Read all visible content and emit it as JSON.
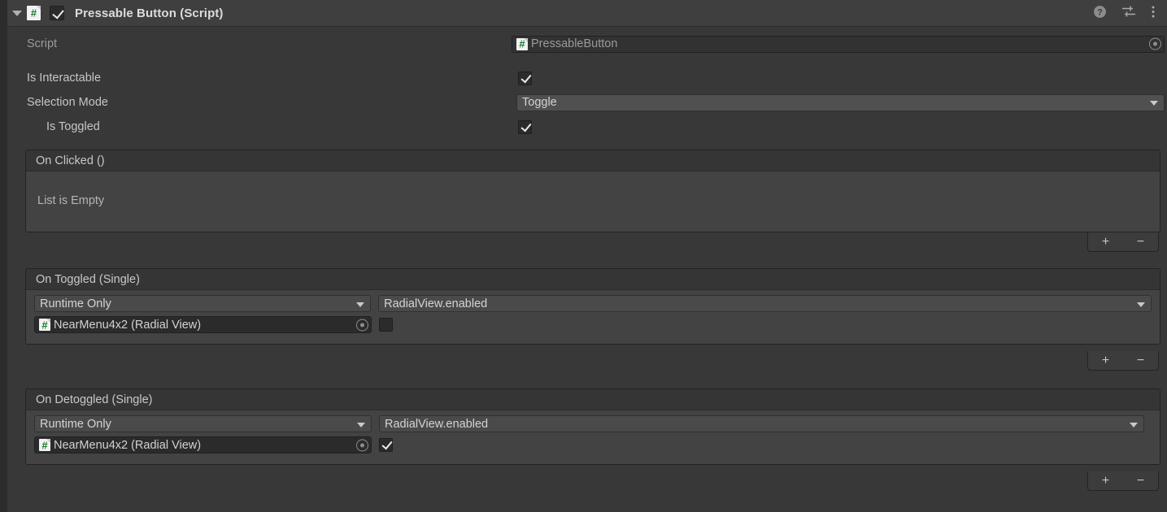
{
  "component": {
    "title": "Pressable Button (Script)",
    "enabled": true,
    "expanded": true,
    "foldout_icon": "triangle-down-icon",
    "script_badge_icon": "csharp-script-icon",
    "header_icons": [
      {
        "name": "help-icon",
        "glyph": "?"
      },
      {
        "name": "preset-icon",
        "glyph": "sliders"
      },
      {
        "name": "more-menu-icon",
        "glyph": "kebab"
      }
    ]
  },
  "fields": {
    "script": {
      "label": "Script",
      "value": "PressableButton",
      "icon": "csharp-script-icon",
      "picker_icon": "object-picker-icon",
      "readonly": true
    },
    "is_interactable": {
      "label": "Is Interactable",
      "checked": true
    },
    "selection_mode": {
      "label": "Selection Mode",
      "value": "Toggle",
      "arrow_icon": "chevron-down-icon"
    },
    "is_toggled": {
      "label": "Is Toggled",
      "checked": true,
      "indented": true
    }
  },
  "events": [
    {
      "id": "on-clicked",
      "header": "On Clicked ()",
      "empty": true,
      "empty_text": "List is Empty",
      "entries": [],
      "footer": {
        "add_label": "+",
        "remove_label": "−"
      }
    },
    {
      "id": "on-toggled",
      "header": "On Toggled (Single)",
      "empty": false,
      "entries": [
        {
          "call_state": "Runtime Only",
          "method": "RadialView.enabled",
          "target_object": "NearMenu4x2 (Radial View)",
          "target_icon": "csharp-script-icon",
          "picker_icon": "object-picker-icon",
          "arg_checked": false
        }
      ],
      "footer": {
        "add_label": "+",
        "remove_label": "−"
      }
    },
    {
      "id": "on-detoggled",
      "header": "On Detoggled (Single)",
      "empty": false,
      "entries": [
        {
          "call_state": "Runtime Only",
          "method": "RadialView.enabled",
          "target_object": "NearMenu4x2 (Radial View)",
          "target_icon": "csharp-script-icon",
          "picker_icon": "object-picker-icon",
          "arg_checked": true
        }
      ],
      "footer": {
        "add_label": "+",
        "remove_label": "−"
      }
    }
  ],
  "colors": {
    "panel_bg": "#383838",
    "header_bg": "#3f3f3f",
    "field_bg": "#2b2b2b",
    "dropdown_bg": "#505050",
    "event_body_bg": "#434343",
    "text": "#c6c6c6",
    "script_icon_green": "#1f7a33"
  }
}
